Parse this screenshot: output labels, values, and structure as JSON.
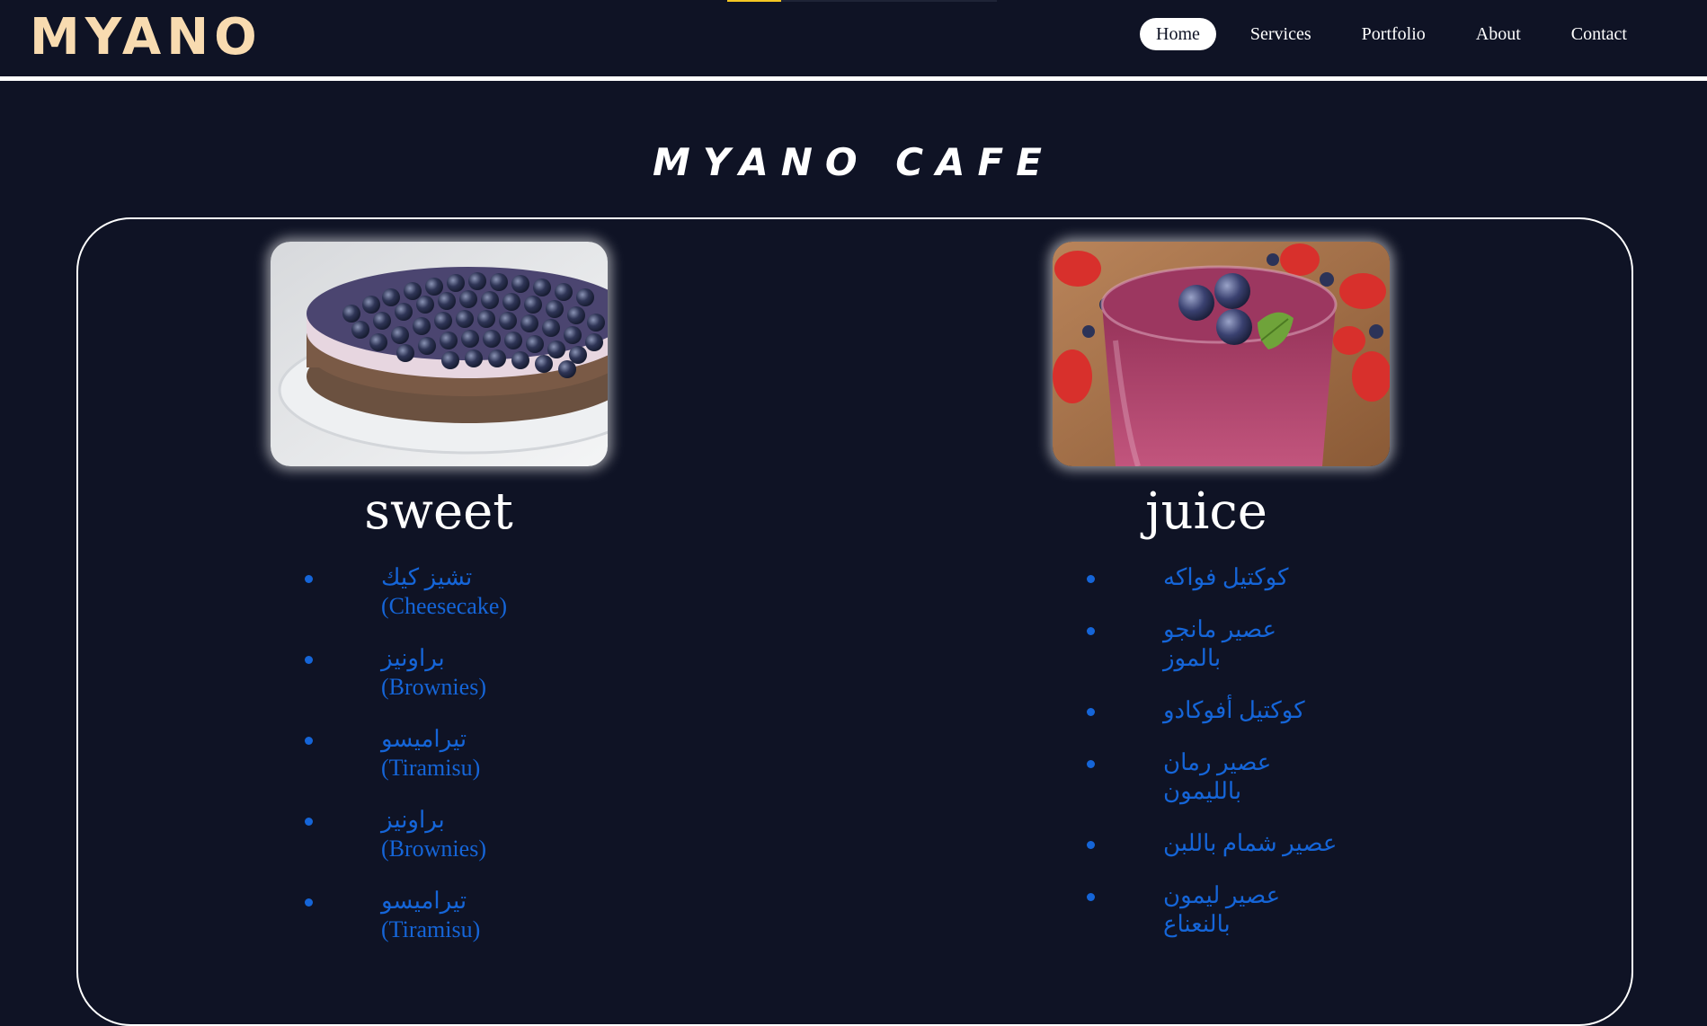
{
  "header": {
    "logo": "MYANO",
    "nav": [
      {
        "label": "Home",
        "active": true
      },
      {
        "label": "Services",
        "active": false
      },
      {
        "label": "Portfolio",
        "active": false
      },
      {
        "label": "About",
        "active": false
      },
      {
        "label": "Contact",
        "active": false
      }
    ]
  },
  "page": {
    "title": "MYANO CAFE"
  },
  "sections": {
    "sweet": {
      "title": "sweet",
      "image": "blueberry-cheesecake-photo",
      "items": [
        {
          "ar": "تشيز كيك",
          "en": "(Cheesecake)"
        },
        {
          "ar": "براونيز",
          "en": "(Brownies)"
        },
        {
          "ar": "تيراميسو",
          "en": "(Tiramisu)"
        },
        {
          "ar": "براونيز",
          "en": "(Brownies)"
        },
        {
          "ar": "تيراميسو",
          "en": "(Tiramisu)"
        }
      ]
    },
    "juice": {
      "title": "juice",
      "image": "berry-smoothie-photo",
      "items": [
        {
          "ar": "كوكتيل فواكه"
        },
        {
          "ar": "عصير مانجو بالموز"
        },
        {
          "ar": "كوكتيل أفوكادو"
        },
        {
          "ar": "عصير رمان بالليمون"
        },
        {
          "ar": "عصير شمام باللبن"
        },
        {
          "ar": "عصير ليمون بالنعناع"
        }
      ]
    }
  },
  "colors": {
    "background": "#0f1325",
    "logo": "#f8dbb0",
    "item_text": "#1565d8",
    "accent": "#f3c623"
  }
}
